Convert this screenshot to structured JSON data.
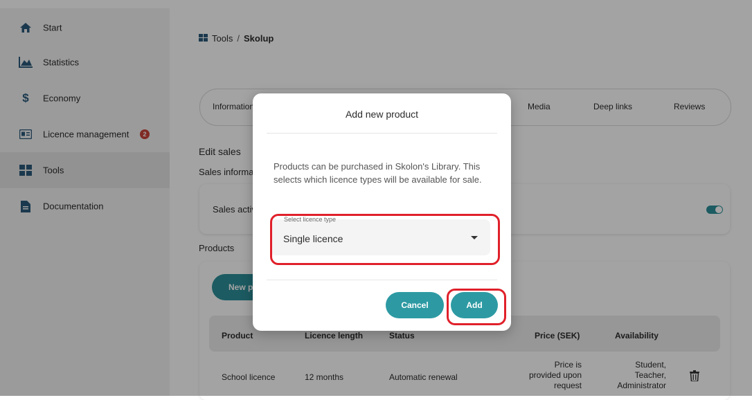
{
  "sidebar": {
    "items": [
      {
        "label": "Start",
        "icon": "home-icon"
      },
      {
        "label": "Statistics",
        "icon": "chart-icon"
      },
      {
        "label": "Economy",
        "icon": "dollar-icon"
      },
      {
        "label": "Licence management",
        "icon": "id-card-icon",
        "badge": "2"
      },
      {
        "label": "Tools",
        "icon": "grid-icon",
        "active": true
      },
      {
        "label": "Documentation",
        "icon": "document-icon"
      }
    ]
  },
  "breadcrumb": {
    "parent": "Tools",
    "separator": "/",
    "current": "Skolup"
  },
  "tabs": [
    {
      "label": "Information"
    },
    {
      "label": "Media"
    },
    {
      "label": "Deep links"
    },
    {
      "label": "Reviews"
    }
  ],
  "main": {
    "edit_heading": "Edit sales",
    "sales_info_heading": "Sales information",
    "sales_active_label": "Sales active",
    "products_heading": "Products",
    "new_product_button": "New product"
  },
  "table": {
    "headers": [
      "Product",
      "Licence length",
      "Status",
      "Price (SEK)",
      "Availability"
    ],
    "rows": [
      {
        "product": "School licence",
        "length": "12 months",
        "status": "Automatic renewal",
        "price": [
          "Price is",
          "provided upon",
          "request"
        ],
        "availability": [
          "Student,",
          "Teacher,",
          "Administrator"
        ]
      }
    ]
  },
  "modal": {
    "title": "Add new product",
    "description": "Products can be purchased in Skolon's Library. This selects which licence types will be available for sale.",
    "select_label": "Select licence type",
    "select_value": "Single licence",
    "cancel_label": "Cancel",
    "add_label": "Add"
  },
  "colors": {
    "accent": "#2d9aa3",
    "annotation": "#e0202a",
    "badge": "#c9443a"
  }
}
